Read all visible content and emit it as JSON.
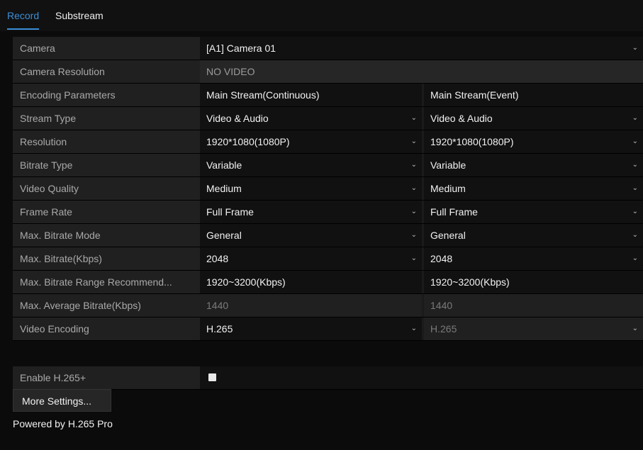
{
  "tabs": [
    {
      "label": "Record",
      "active": true
    },
    {
      "label": "Substream",
      "active": false
    }
  ],
  "camera": {
    "label": "Camera",
    "value": "[A1] Camera 01"
  },
  "camera_resolution": {
    "label": "Camera Resolution",
    "value": "NO VIDEO"
  },
  "encoding_parameters": {
    "label": "Encoding Parameters",
    "col1": "Main Stream(Continuous)",
    "col2": "Main Stream(Event)"
  },
  "rows": [
    {
      "label": "Stream Type",
      "col1": "Video & Audio",
      "col2": "Video & Audio"
    },
    {
      "label": "Resolution",
      "col1": "1920*1080(1080P)",
      "col2": "1920*1080(1080P)"
    },
    {
      "label": "Bitrate Type",
      "col1": "Variable",
      "col2": "Variable"
    },
    {
      "label": "Video Quality",
      "col1": "Medium",
      "col2": "Medium"
    },
    {
      "label": "Frame Rate",
      "col1": "Full Frame",
      "col2": "Full Frame"
    },
    {
      "label": "Max. Bitrate Mode",
      "col1": "General",
      "col2": "General"
    },
    {
      "label": "Max. Bitrate(Kbps)",
      "col1": "2048",
      "col2": "2048"
    }
  ],
  "range": {
    "label": "Max. Bitrate Range Recommend...",
    "col1": "1920~3200(Kbps)",
    "col2": "1920~3200(Kbps)"
  },
  "average": {
    "label": "Max. Average Bitrate(Kbps)",
    "col1": "1440",
    "col2": "1440"
  },
  "video_encoding": {
    "label": "Video Encoding",
    "col1": "H.265",
    "col2": "H.265"
  },
  "enable_h265plus": {
    "label": "Enable H.265+",
    "checked": true
  },
  "more_settings": {
    "label": "More Settings..."
  },
  "footer": {
    "text": "Powered by H.265 Pro"
  },
  "icons": {
    "dropdown": "chevron-down-icon",
    "checkbox": "checkbox-icon"
  },
  "colors": {
    "accent": "#3a8fd8",
    "background": "#0b0b0b"
  }
}
